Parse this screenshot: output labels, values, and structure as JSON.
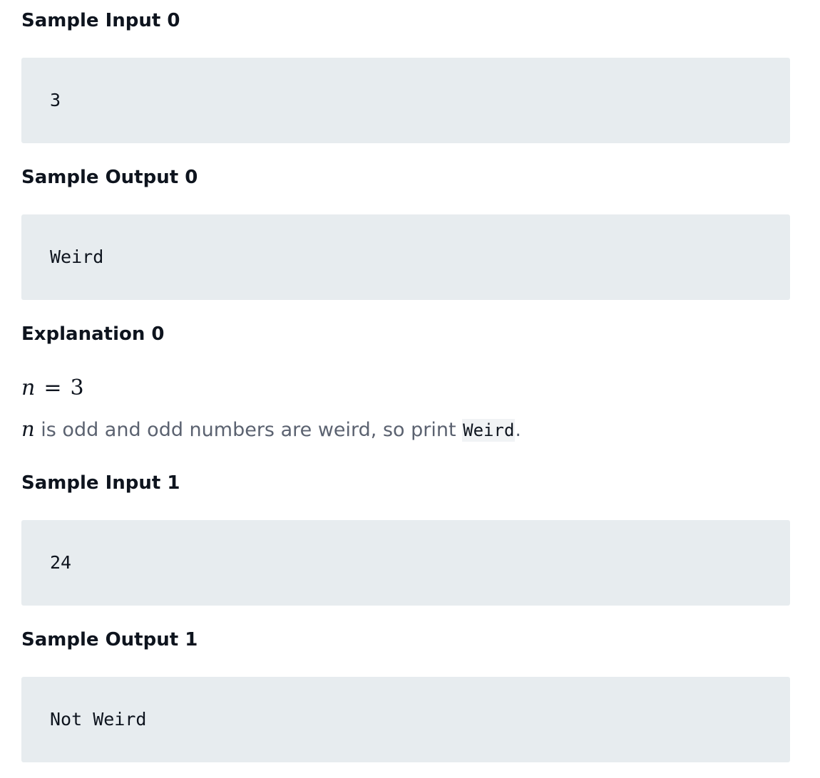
{
  "sample0": {
    "input_heading": "Sample Input 0",
    "input_value": "3",
    "output_heading": "Sample Output 0",
    "output_value": "Weird",
    "explanation_heading": "Explanation 0",
    "math": {
      "variable": "n",
      "operator": "=",
      "value": "3"
    },
    "explanation": {
      "variable": "n",
      "text": " is odd and odd numbers are weird, so print ",
      "code": "Weird",
      "suffix": "."
    }
  },
  "sample1": {
    "input_heading": "Sample Input 1",
    "input_value": "24",
    "output_heading": "Sample Output 1",
    "output_value": "Not Weird"
  }
}
